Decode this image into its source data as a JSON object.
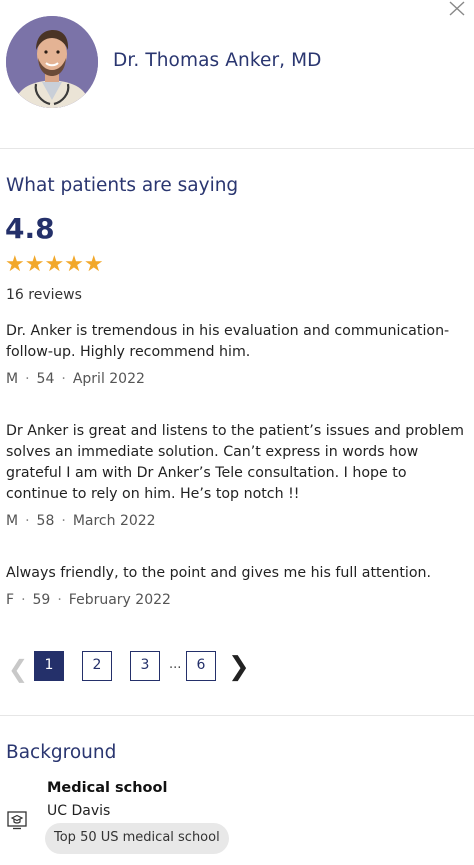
{
  "doctor": {
    "name": "Dr. Thomas Anker, MD",
    "avatar_bg": "#7b73a8"
  },
  "reviews_section": {
    "title": "What patients are saying",
    "rating": "4.8",
    "stars": 5,
    "stars_text": "★★★★★",
    "count_label": "16  reviews",
    "items": [
      {
        "text": "Dr. Anker is tremendous in his evaluation and communication-follow-up. Highly recommend him.",
        "gender": "M",
        "age": "54",
        "date": "April 2022"
      },
      {
        "text": "Dr Anker is great and listens to the patient’s issues and problem solves an immediate solution. Can’t express in words how grateful I am with Dr Anker’s Tele consultation. I hope to continue to rely on him. He’s top notch !!",
        "gender": "M",
        "age": "58",
        "date": "March 2022"
      },
      {
        "text": "Always friendly, to the point and gives me his full attention.",
        "gender": "F",
        "age": "59",
        "date": "February 2022"
      }
    ],
    "pagination": {
      "pages": [
        "1",
        "2",
        "3",
        "6"
      ],
      "current": "1",
      "ellipsis": "..."
    }
  },
  "background_section": {
    "title": "Background",
    "education": {
      "type": "Medical school",
      "school": "UC Davis",
      "badge": "Top 50 US medical school"
    }
  },
  "colors": {
    "brand": "#24306a",
    "star": "#f2a82a"
  }
}
